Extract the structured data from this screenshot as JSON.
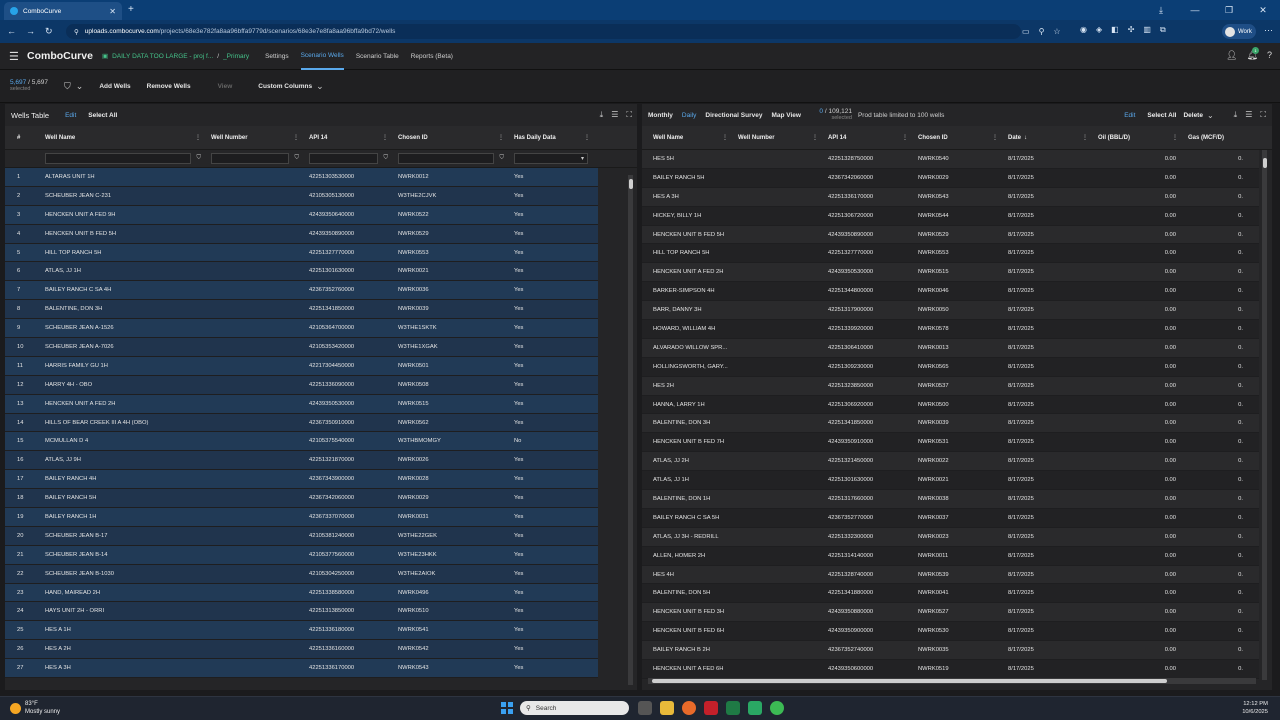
{
  "browser": {
    "tab_title": "ComboCurve",
    "url_host": "uploads.combocurve.com",
    "url_path": "/projects/68e3e782fa8aa96bffa9779d/scenarios/68e3e7e8fa8aa96bffa9bd72/wells",
    "profile": "Work"
  },
  "app": {
    "logo": "ComboCurve",
    "project": "DAILY DATA TOO LARGE - proj f...",
    "project_sep": "/",
    "scenario": "_Primary",
    "nav": [
      "Settings",
      "Scenario Wells",
      "Scenario Table",
      "Reports (Beta)"
    ],
    "active_nav": "Scenario Wells",
    "notif_count": "1"
  },
  "toolbar": {
    "selected_n": "5,697",
    "selected_total": " / 5,697",
    "selected_label": "selected",
    "add": "Add Wells",
    "remove": "Remove Wells",
    "view": "View",
    "custom": "Custom Columns"
  },
  "left": {
    "title": "Wells Table",
    "edit": "Edit",
    "select_all": "Select All",
    "columns": [
      "#",
      "Well Name",
      "Well Number",
      "API 14",
      "Chosen ID",
      "Has Daily Data"
    ],
    "rows": [
      [
        "1",
        "ALTARAS UNIT 1H",
        "",
        "42251303530000",
        "NWRK0012",
        "Yes"
      ],
      [
        "2",
        "SCHEUBER JEAN C-231",
        "",
        "42105305130000",
        "W3THE2CJVK",
        "Yes"
      ],
      [
        "3",
        "HENCKEN UNIT A FED 9H",
        "",
        "42439350640000",
        "NWRK0522",
        "Yes"
      ],
      [
        "4",
        "HENCKEN UNIT B FED 5H",
        "",
        "42439350890000",
        "NWRK0529",
        "Yes"
      ],
      [
        "5",
        "HILL TOP RANCH 5H",
        "",
        "42251327770000",
        "NWRK0553",
        "Yes"
      ],
      [
        "6",
        "ATLAS, JJ 1H",
        "",
        "42251301630000",
        "NWRK0021",
        "Yes"
      ],
      [
        "7",
        "BAILEY RANCH C SA 4H",
        "",
        "42367352760000",
        "NWRK0036",
        "Yes"
      ],
      [
        "8",
        "BALENTINE, DON 3H",
        "",
        "42251341850000",
        "NWRK0039",
        "Yes"
      ],
      [
        "9",
        "SCHEUBER JEAN A-1526",
        "",
        "42105364700000",
        "W3THE1SKTK",
        "Yes"
      ],
      [
        "10",
        "SCHEUBER JEAN A-7026",
        "",
        "42105353420000",
        "W3THE1XGAK",
        "Yes"
      ],
      [
        "11",
        "HARRIS FAMILY GU 1H",
        "",
        "42217304450000",
        "NWRK0501",
        "Yes"
      ],
      [
        "12",
        "HARRY 4H - OBO",
        "",
        "42251336090000",
        "NWRK0508",
        "Yes"
      ],
      [
        "13",
        "HENCKEN UNIT A FED 2H",
        "",
        "42439350530000",
        "NWRK0515",
        "Yes"
      ],
      [
        "14",
        "HILLS OF BEAR CREEK III A 4H (OBO)",
        "",
        "42367350910000",
        "NWRK0562",
        "Yes"
      ],
      [
        "15",
        "MCMULLAN D 4",
        "",
        "42105375540000",
        "W3THBMOMGY",
        "No"
      ],
      [
        "16",
        "ATLAS, JJ 9H",
        "",
        "42251321870000",
        "NWRK0026",
        "Yes"
      ],
      [
        "17",
        "BAILEY RANCH 4H",
        "",
        "42367343900000",
        "NWRK0028",
        "Yes"
      ],
      [
        "18",
        "BAILEY RANCH 5H",
        "",
        "42367342060000",
        "NWRK0029",
        "Yes"
      ],
      [
        "19",
        "BAILEY RANCH 1H",
        "",
        "42367337070000",
        "NWRK0031",
        "Yes"
      ],
      [
        "20",
        "SCHEUBER JEAN B-17",
        "",
        "42105381240000",
        "W3THE22GEK",
        "Yes"
      ],
      [
        "21",
        "SCHEUBER JEAN B-14",
        "",
        "42105377560000",
        "W3THE23HKK",
        "Yes"
      ],
      [
        "22",
        "SCHEUBER JEAN B-1030",
        "",
        "42105304250000",
        "W3THE2AIOK",
        "Yes"
      ],
      [
        "23",
        "HAND, MAIREAD 2H",
        "",
        "42251338580000",
        "NWRK0496",
        "Yes"
      ],
      [
        "24",
        "HAYS UNIT 2H - ORRI",
        "",
        "42251313850000",
        "NWRK0510",
        "Yes"
      ],
      [
        "25",
        "HES A 1H",
        "",
        "42251336180000",
        "NWRK0541",
        "Yes"
      ],
      [
        "26",
        "HES A 2H",
        "",
        "42251336160000",
        "NWRK0542",
        "Yes"
      ],
      [
        "27",
        "HES A 3H",
        "",
        "42251336170000",
        "NWRK0543",
        "Yes"
      ]
    ]
  },
  "right": {
    "tabs": [
      "Monthly",
      "Daily",
      "Directional Survey",
      "Map View"
    ],
    "active_tab": "Daily",
    "selected_n": "0",
    "selected_total": " / 109,121",
    "selected_label": "selected",
    "limit_note": "Prod table limited to 100 wells",
    "edit": "Edit",
    "select_all": "Select All",
    "delete": "Delete",
    "columns": [
      "Well Name",
      "Well Number",
      "API 14",
      "Chosen ID",
      "Date",
      "Oil (BBL/D)",
      "Gas (MCF/D)"
    ],
    "rows": [
      [
        "HES 5H",
        "",
        "42251328750000",
        "NWRK0540",
        "8/17/2025",
        "0.00",
        "0."
      ],
      [
        "BAILEY RANCH 5H",
        "",
        "42367342060000",
        "NWRK0029",
        "8/17/2025",
        "0.00",
        "0."
      ],
      [
        "HES A 3H",
        "",
        "42251336170000",
        "NWRK0543",
        "8/17/2025",
        "0.00",
        "0."
      ],
      [
        "HICKEY, BILLY 1H",
        "",
        "42251306720000",
        "NWRK0544",
        "8/17/2025",
        "0.00",
        "0."
      ],
      [
        "HENCKEN UNIT B FED 5H",
        "",
        "42439350890000",
        "NWRK0529",
        "8/17/2025",
        "0.00",
        "0."
      ],
      [
        "HILL TOP RANCH 5H",
        "",
        "42251327770000",
        "NWRK0553",
        "8/17/2025",
        "0.00",
        "0."
      ],
      [
        "HENCKEN UNIT A FED 2H",
        "",
        "42439350530000",
        "NWRK0515",
        "8/17/2025",
        "0.00",
        "0."
      ],
      [
        "BARKER-SIMPSON 4H",
        "",
        "42251344800000",
        "NWRK0046",
        "8/17/2025",
        "0.00",
        "0."
      ],
      [
        "BARR, DANNY 3H",
        "",
        "42251317900000",
        "NWRK0050",
        "8/17/2025",
        "0.00",
        "0."
      ],
      [
        "HOWARD, WILLIAM 4H",
        "",
        "42251339920000",
        "NWRK0578",
        "8/17/2025",
        "0.00",
        "0."
      ],
      [
        "ALVARADO WILLOW SPR...",
        "",
        "42251306410000",
        "NWRK0013",
        "8/17/2025",
        "0.00",
        "0."
      ],
      [
        "HOLLINGSWORTH, GARY...",
        "",
        "42251309230000",
        "NWRK0565",
        "8/17/2025",
        "0.00",
        "0."
      ],
      [
        "HES 2H",
        "",
        "42251323850000",
        "NWRK0537",
        "8/17/2025",
        "0.00",
        "0."
      ],
      [
        "HANNA, LARRY 1H",
        "",
        "42251306920000",
        "NWRK0500",
        "8/17/2025",
        "0.00",
        "0."
      ],
      [
        "BALENTINE, DON 3H",
        "",
        "42251341850000",
        "NWRK0039",
        "8/17/2025",
        "0.00",
        "0."
      ],
      [
        "HENCKEN UNIT B FED 7H",
        "",
        "42439350910000",
        "NWRK0531",
        "8/17/2025",
        "0.00",
        "0."
      ],
      [
        "ATLAS, JJ 2H",
        "",
        "42251321450000",
        "NWRK0022",
        "8/17/2025",
        "0.00",
        "0."
      ],
      [
        "ATLAS, JJ 1H",
        "",
        "42251301630000",
        "NWRK0021",
        "8/17/2025",
        "0.00",
        "0."
      ],
      [
        "BALENTINE, DON 1H",
        "",
        "42251317660000",
        "NWRK0038",
        "8/17/2025",
        "0.00",
        "0."
      ],
      [
        "BAILEY RANCH C SA 5H",
        "",
        "42367352770000",
        "NWRK0037",
        "8/17/2025",
        "0.00",
        "0."
      ],
      [
        "ATLAS, JJ 3H - REDRILL",
        "",
        "42251332300000",
        "NWRK0023",
        "8/17/2025",
        "0.00",
        "0."
      ],
      [
        "ALLEN, HOMER 2H",
        "",
        "42251314140000",
        "NWRK0011",
        "8/17/2025",
        "0.00",
        "0."
      ],
      [
        "HES 4H",
        "",
        "42251328740000",
        "NWRK0539",
        "8/17/2025",
        "0.00",
        "0."
      ],
      [
        "BALENTINE, DON 5H",
        "",
        "42251341880000",
        "NWRK0041",
        "8/17/2025",
        "0.00",
        "0."
      ],
      [
        "HENCKEN UNIT B FED 3H",
        "",
        "42439350880000",
        "NWRK0527",
        "8/17/2025",
        "0.00",
        "0."
      ],
      [
        "HENCKEN UNIT B FED 6H",
        "",
        "42439350900000",
        "NWRK0530",
        "8/17/2025",
        "0.00",
        "0."
      ],
      [
        "BAILEY RANCH B 2H",
        "",
        "42367352740000",
        "NWRK0035",
        "8/17/2025",
        "0.00",
        "0."
      ],
      [
        "HENCKEN UNIT A FED 6H",
        "",
        "42439350600000",
        "NWRK0519",
        "8/17/2025",
        "0.00",
        "0."
      ]
    ]
  },
  "taskbar": {
    "temp": "83°F",
    "weather": "Mostly sunny",
    "search": "Search",
    "time": "12:12 PM",
    "date": "10/6/2025"
  },
  "colors": {
    "accent": "#5aa9ec",
    "project_green": "#45c38a",
    "selected_row": "#213a56"
  }
}
